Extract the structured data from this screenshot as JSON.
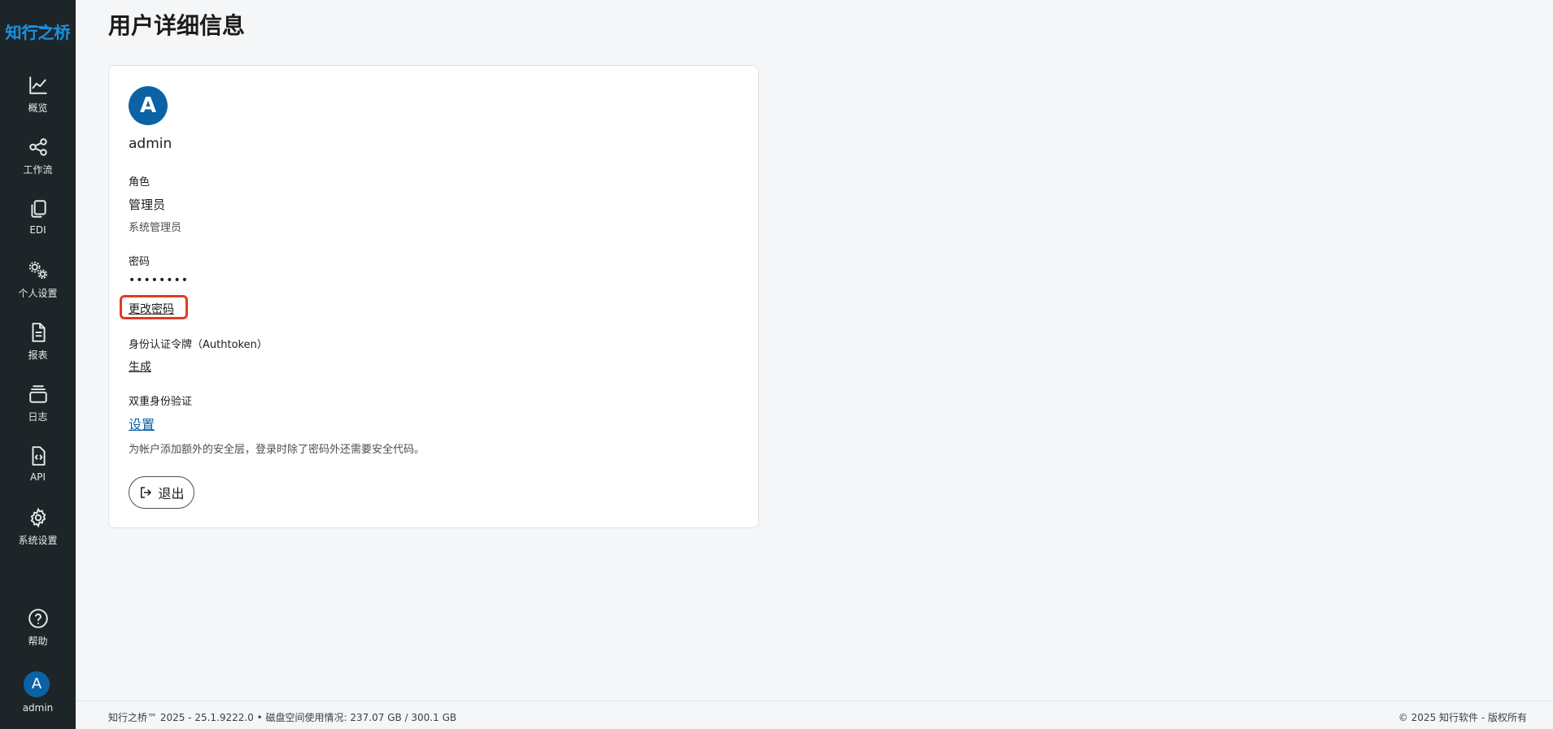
{
  "sidebar": {
    "logo_text": "知行之桥",
    "items": [
      {
        "label": "概览",
        "icon": "chart-line-icon"
      },
      {
        "label": "工作流",
        "icon": "share-nodes-icon"
      },
      {
        "label": "EDI",
        "icon": "copy-documents-icon"
      },
      {
        "label": "个人设置",
        "icon": "gears-icon"
      },
      {
        "label": "报表",
        "icon": "document-icon"
      },
      {
        "label": "日志",
        "icon": "stack-layers-icon"
      },
      {
        "label": "API",
        "icon": "code-file-icon"
      },
      {
        "label": "系统设置",
        "icon": "gear-icon"
      },
      {
        "label": "帮助",
        "icon": "help-circle-icon"
      }
    ],
    "user": {
      "initial": "A",
      "name": "admin"
    }
  },
  "page": {
    "title": "用户详细信息"
  },
  "card": {
    "avatar_initial": "A",
    "username": "admin",
    "role_label": "角色",
    "role_value": "管理员",
    "role_desc": "系统管理员",
    "password_label": "密码",
    "password_value": "••••••••",
    "change_password": "更改密码",
    "authtoken_label": "身份认证令牌（Authtoken）",
    "authtoken_action": "生成",
    "twofa_label": "双重身份验证",
    "twofa_action": "设置",
    "twofa_desc": "为帐户添加额外的安全层，登录时除了密码外还需要安全代码。",
    "logout": "退出"
  },
  "footer": {
    "left": "知行之桥™ 2025 - 25.1.9222.0  •  磁盘空间使用情况:  237.07 GB / 300.1 GB",
    "right": "© 2025 知行软件 - 版权所有"
  },
  "colors": {
    "sidebar_bg": "#1e2529",
    "accent_blue": "#0b63a6",
    "logo_blue": "#1a8fe0",
    "highlight_red": "#e53a24"
  }
}
